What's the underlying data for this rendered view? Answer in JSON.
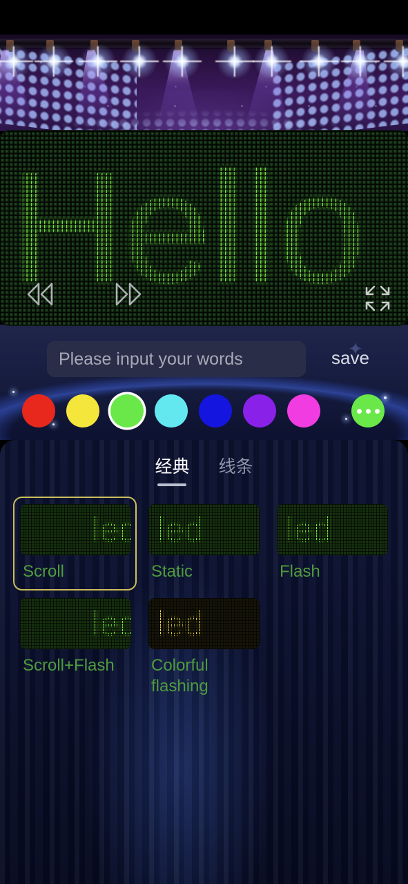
{
  "app": {
    "background_style": "stage-lights-banner"
  },
  "led_display": {
    "text": "Hello",
    "text_color": "#79e03a",
    "panel_bg": "#0d1c0d",
    "controls": {
      "rewind": "rewind-icon",
      "forward": "forward-icon",
      "fullscreen": "fullscreen-icon"
    }
  },
  "input_row": {
    "placeholder": "Please input your words",
    "value": "",
    "save_label": "save"
  },
  "colors": {
    "selected_index": 2,
    "swatches": [
      {
        "name": "red",
        "hex": "#e8281c"
      },
      {
        "name": "yellow",
        "hex": "#f5e63c"
      },
      {
        "name": "green",
        "hex": "#6ae84a"
      },
      {
        "name": "cyan",
        "hex": "#63e8f0"
      },
      {
        "name": "blue",
        "hex": "#1515e0"
      },
      {
        "name": "purple",
        "hex": "#8a21e8"
      },
      {
        "name": "magenta",
        "hex": "#f03ce0"
      },
      {
        "name": "more",
        "hex": "#6ae84a"
      }
    ]
  },
  "tabs": [
    {
      "id": "classic",
      "label": "经典",
      "active": true
    },
    {
      "id": "lines",
      "label": "线条",
      "active": false
    }
  ],
  "effects": {
    "selected_id": "scroll",
    "items": [
      {
        "id": "scroll",
        "label": "Scroll",
        "preview_text": "led",
        "preview_color": "#7ce33c",
        "preview_bg": "green",
        "align": "right",
        "selected": true
      },
      {
        "id": "static",
        "label": "Static",
        "preview_text": "led",
        "preview_color": "#7ce33c",
        "preview_bg": "green",
        "align": "left",
        "selected": false
      },
      {
        "id": "flash",
        "label": "Flash",
        "preview_text": "led",
        "preview_color": "#7ce33c",
        "preview_bg": "green",
        "align": "left",
        "selected": false
      },
      {
        "id": "scroll_flash",
        "label": "Scroll+Flash",
        "preview_text": "led",
        "preview_color": "#7ce33c",
        "preview_bg": "green",
        "align": "right",
        "selected": false
      },
      {
        "id": "colorful_flash",
        "label": "Colorful flashing",
        "preview_text": "led",
        "preview_color": "#e8d53c",
        "preview_bg": "dark",
        "align": "left",
        "selected": false
      }
    ]
  }
}
